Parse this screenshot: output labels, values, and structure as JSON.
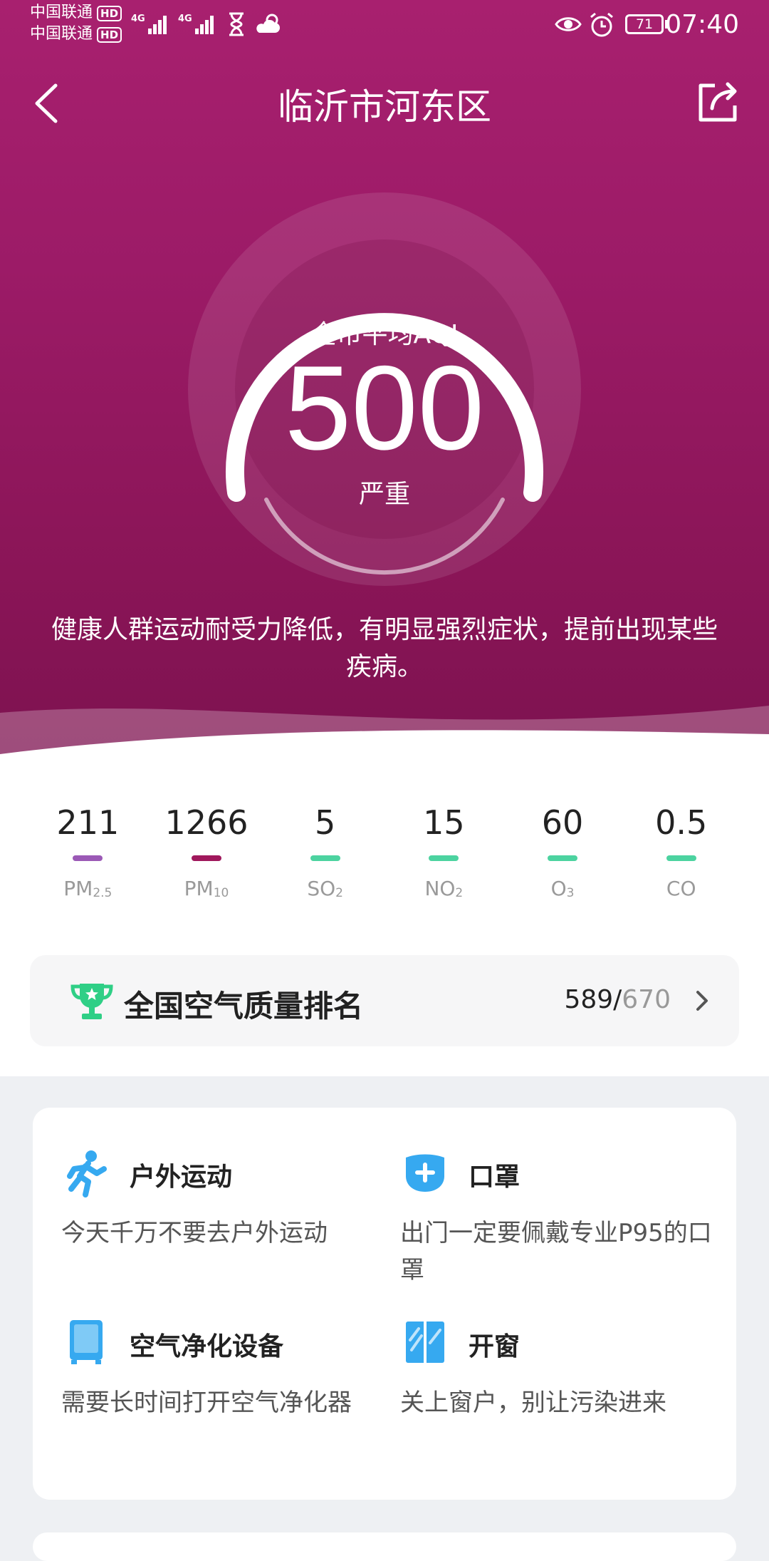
{
  "status_bar": {
    "carrier1": "中国联通",
    "carrier2": "中国联通",
    "hd": "HD",
    "network": "4G",
    "battery": "71",
    "time": "07:40"
  },
  "header": {
    "title": "临沂市河东区"
  },
  "aqi": {
    "label": "全市平均AQI",
    "value": "500",
    "level": "严重",
    "gauge_fraction": 1.0,
    "description": "健康人群运动耐受力降低，有明显强烈症状，提前出现某些疾病。"
  },
  "pollutants": [
    {
      "value": "211",
      "name": "PM",
      "sub": "2.5",
      "color": "#9b59b6"
    },
    {
      "value": "1266",
      "name": "PM",
      "sub": "10",
      "color": "#a0185c"
    },
    {
      "value": "5",
      "name": "SO",
      "sub": "2",
      "color": "#4cd3a0"
    },
    {
      "value": "15",
      "name": "NO",
      "sub": "2",
      "color": "#4cd3a0"
    },
    {
      "value": "60",
      "name": "O",
      "sub": "3",
      "color": "#4cd3a0"
    },
    {
      "value": "0.5",
      "name": "CO",
      "sub": "",
      "color": "#4cd3a0"
    }
  ],
  "ranking": {
    "title": "全国空气质量排名",
    "rank": "589/",
    "total": "670"
  },
  "advice": [
    {
      "icon": "running-person-icon",
      "title": "户外运动",
      "desc": "今天千万不要去户外运动"
    },
    {
      "icon": "mask-icon",
      "title": "口罩",
      "desc": "出门一定要佩戴专业P95的口罩"
    },
    {
      "icon": "air-purifier-icon",
      "title": "空气净化设备",
      "desc": "需要长时间打开空气净化器"
    },
    {
      "icon": "window-icon",
      "title": "开窗",
      "desc": "关上窗户，别让污染进来"
    }
  ],
  "colors": {
    "hero": "#9c1b67",
    "accent_green": "#2fcf86",
    "icon_blue": "#36a9f0"
  }
}
